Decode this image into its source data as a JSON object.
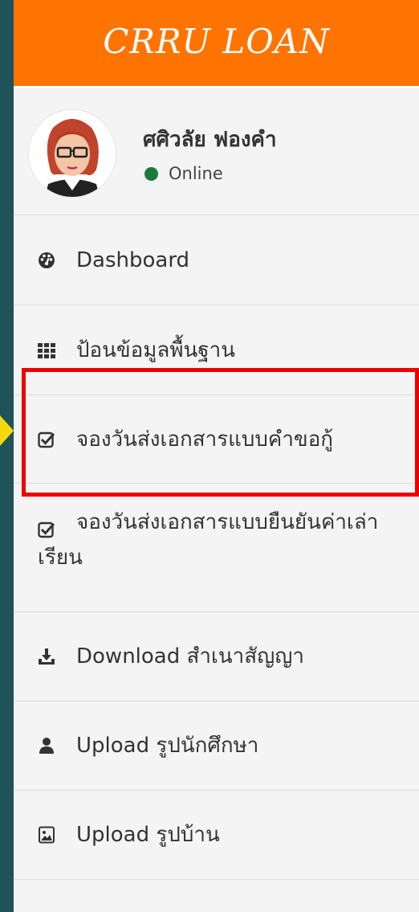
{
  "brand": {
    "title": "CRRU LOAN"
  },
  "user": {
    "name": "ศศิวลัย ฟองคำ",
    "status": "Online",
    "status_color": "#1b7a3e"
  },
  "menu": [
    {
      "label": "Dashboard",
      "icon": "dashboard-icon"
    },
    {
      "label": "ป้อนข้อมูลพื้นฐาน",
      "icon": "grid-icon"
    },
    {
      "label": "จองวันส่งเอกสารแบบคำขอกู้",
      "icon": "checkbox-icon"
    },
    {
      "label": "จองวันส่งเอกสารแบบยืนยันค่าเล่าเรียน",
      "icon": "checkbox-icon"
    },
    {
      "label": "Download สำเนาสัญญา",
      "icon": "download-icon"
    },
    {
      "label": "Upload รูปนักศึกษา",
      "icon": "user-icon"
    },
    {
      "label": "Upload รูปบ้าน",
      "icon": "image-icon"
    }
  ],
  "colors": {
    "header": "#ff7400",
    "highlight": "#ee0000",
    "pointer": "#f5d90a",
    "background": "#1f5259"
  }
}
